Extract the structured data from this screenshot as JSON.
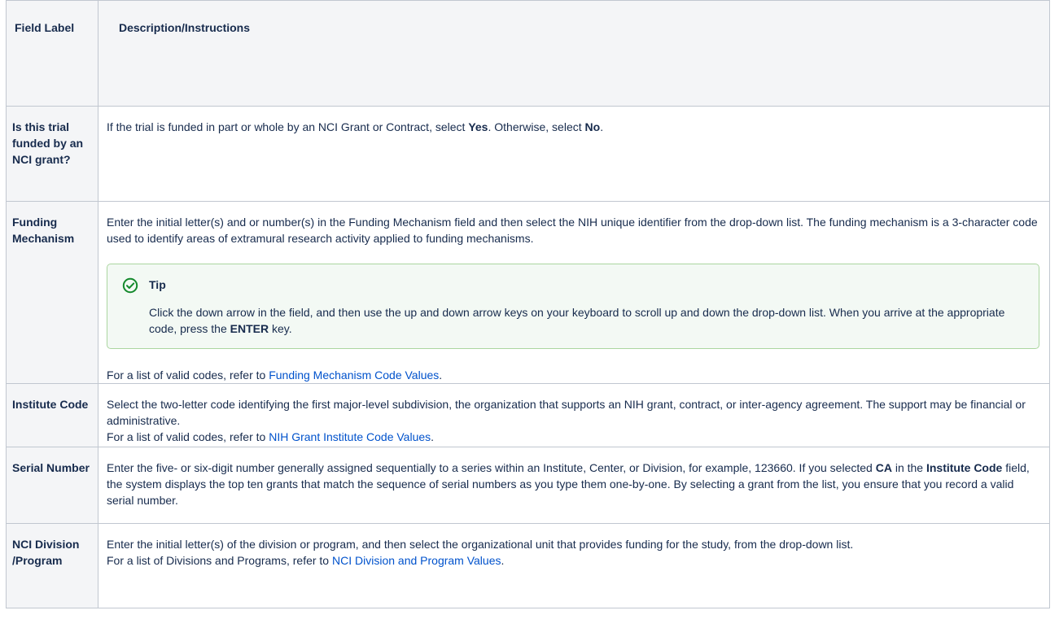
{
  "table": {
    "headers": [
      "Field Label",
      "Description/Instructions"
    ],
    "rows": [
      {
        "label": "Is this trial funded by an NCI grant?",
        "desc": {
          "t1": "If the trial is funded in part or whole by an NCI Grant or Contract, select ",
          "b1": "Yes",
          "t2": ". Otherwise, select ",
          "b2": "No",
          "t3": "."
        }
      },
      {
        "label": "Funding Mechanism",
        "desc": {
          "p1": "Enter the initial letter(s) and or number(s) in the Funding Mechanism field and then select the NIH unique identifier from the drop-down list. The funding mechanism is a 3-character code used to identify areas of extramural research activity applied to funding mechanisms.",
          "tip_title": "Tip",
          "tip_t1": "Click the down arrow in the field, and then use the up and down arrow keys on your keyboard to scroll up and down the drop-down list. When you arrive at the appropriate code, press the ",
          "tip_b1": "ENTER",
          "tip_t2": " key.",
          "p2_pre": "For a list of valid codes, refer to ",
          "p2_link": "Funding Mechanism Code Values",
          "p2_post": "."
        }
      },
      {
        "label": "Institute Code",
        "desc": {
          "p1": "Select the two-letter code identifying the first major-level subdivision, the organization that supports an NIH grant, contract, or inter-agency agreement. The support may be financial or administrative.",
          "p2_pre": "For a list of valid codes, refer to ",
          "p2_link": "NIH Grant Institute Code Values",
          "p2_post": "."
        }
      },
      {
        "label": "Serial Number",
        "desc": {
          "t1": "Enter the five- or six-digit number generally assigned sequentially to a series within an Institute, Center, or Division, for example, 123660. If you selected ",
          "b1": "CA",
          "t2": " in the ",
          "b2": "Institute Code",
          "t3": " field, the system displays the top ten grants that match the sequence of serial numbers as you type them one-by-one. By selecting a grant from the list, you ensure that you record a valid serial number."
        }
      },
      {
        "label": "NCI Division /Program",
        "desc": {
          "p1": "Enter the initial letter(s) of the division or program, and then select the organizational unit that provides funding for the study, from the drop-down list.",
          "p2_pre": "For a list of Divisions and Programs, refer to ",
          "p2_link": "NCI Division and Program Values",
          "p2_post": "."
        }
      }
    ]
  },
  "icons": {
    "tip": "check-circle-icon"
  },
  "colors": {
    "link": "#0052cc",
    "tip_border": "#abd6a0",
    "tip_bg": "#f3f9f4",
    "tip_icon": "#14892c",
    "header_bg": "#f4f5f7"
  }
}
